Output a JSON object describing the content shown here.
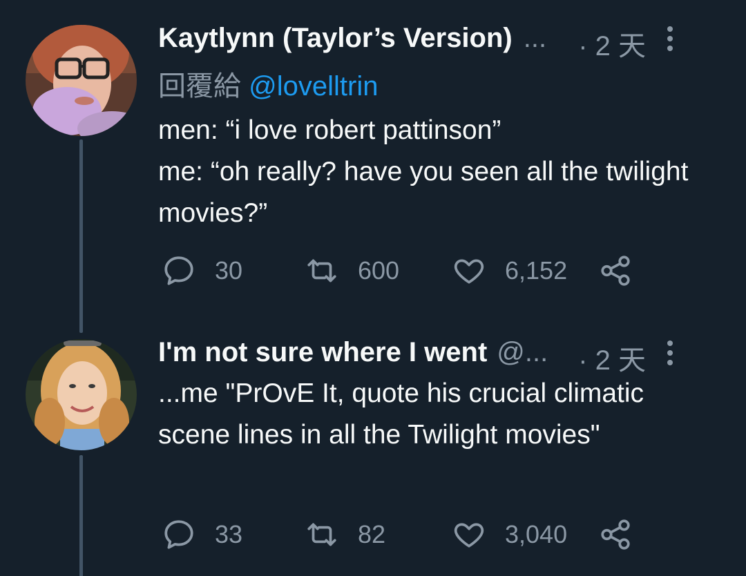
{
  "tweets": [
    {
      "display_name": "Kaytlynn (Taylor’s Version)",
      "name_ellipsis": "...",
      "timestamp": "· 2 天",
      "reply_prefix": "回覆給",
      "reply_to": "@lovelltrin",
      "text": "men: “i love robert pattinson”\nme: “oh really? have you seen all the twilight movies?”",
      "replies": "30",
      "retweets": "600",
      "likes": "6,152",
      "avatar_icon": "avatar-icon"
    },
    {
      "display_name": "I'm not sure where I went",
      "handle": "@...",
      "timestamp": "· 2 天",
      "text": "...me \"PrOvE It, quote his crucial climatic scene lines in all the Twilight movies\"",
      "replies": "33",
      "retweets": "82",
      "likes": "3,040",
      "avatar_icon": "avatar-icon"
    }
  ],
  "colors": {
    "background": "#15202b",
    "text": "#f7f9f9",
    "secondary": "#8b98a5",
    "accent": "#1d9bf0",
    "thread_line": "#425466"
  }
}
